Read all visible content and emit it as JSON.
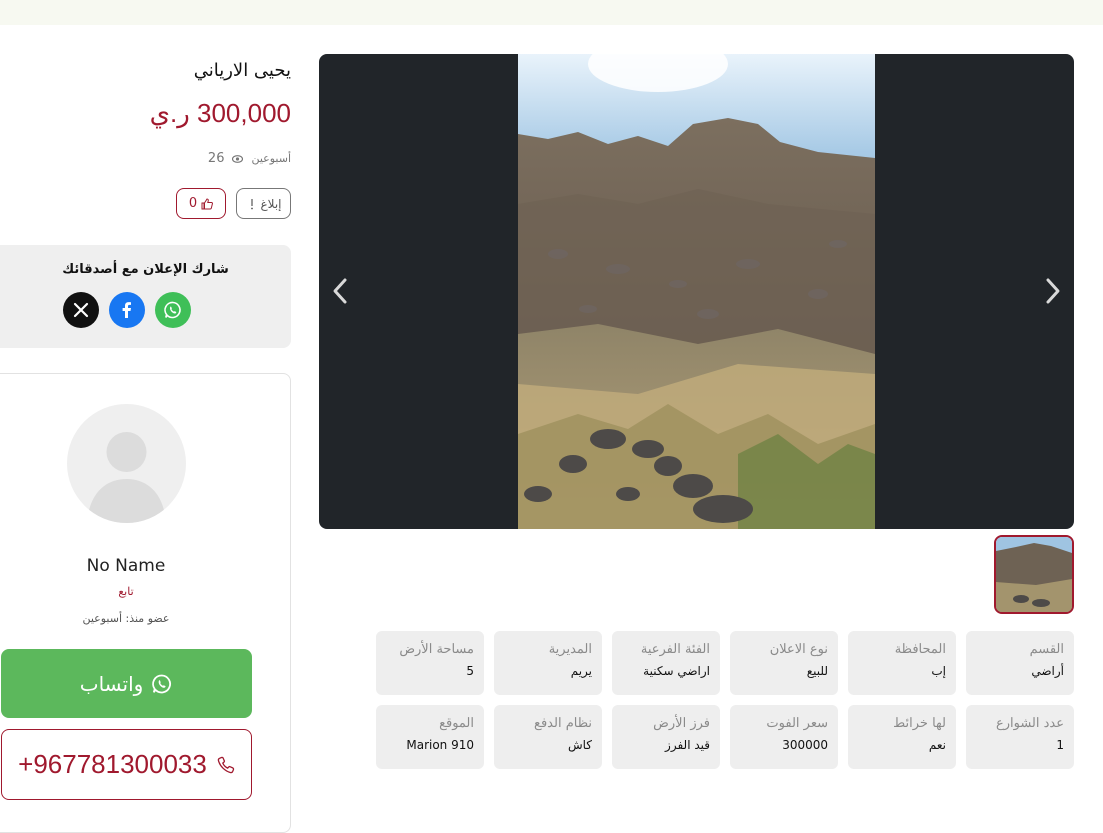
{
  "listing": {
    "title": "يحيى الارياني",
    "price": "300,000 ر.ي",
    "posted": "أسبوعين",
    "views": "26",
    "report_label": "إبلاغ",
    "likes": "0"
  },
  "share": {
    "title": "شارك الإعلان مع أصدقائك",
    "networks": [
      "x-icon",
      "facebook-icon",
      "whatsapp-icon"
    ]
  },
  "seller": {
    "name": "No Name",
    "role": "تابع",
    "member_since": "عضو منذ: أسبوعين",
    "whatsapp_label": "واتساب",
    "phone": "+967781300033"
  },
  "details": [
    {
      "key": "القسم",
      "value": "أراضي"
    },
    {
      "key": "المحافظة",
      "value": "إب"
    },
    {
      "key": "نوع الاعلان",
      "value": "للبيع"
    },
    {
      "key": "الفئة الفرعية",
      "value": "اراضي سكنية"
    },
    {
      "key": "المديرية",
      "value": "يريم"
    },
    {
      "key": "مساحة الأرض",
      "value": "5"
    },
    {
      "key": "عدد الشوارع",
      "value": "1"
    },
    {
      "key": "لها خرائط",
      "value": "نعم"
    },
    {
      "key": "سعر الفوت",
      "value": "300000"
    },
    {
      "key": "فرز الأرض",
      "value": "قيد الفرز"
    },
    {
      "key": "نظام الدفع",
      "value": "كاش"
    },
    {
      "key": "الموقع",
      "value": "Marion 910"
    }
  ],
  "colors": {
    "brand": "#a0192e",
    "whatsapp": "#5cb85c",
    "gallery_bg": "#212529"
  }
}
